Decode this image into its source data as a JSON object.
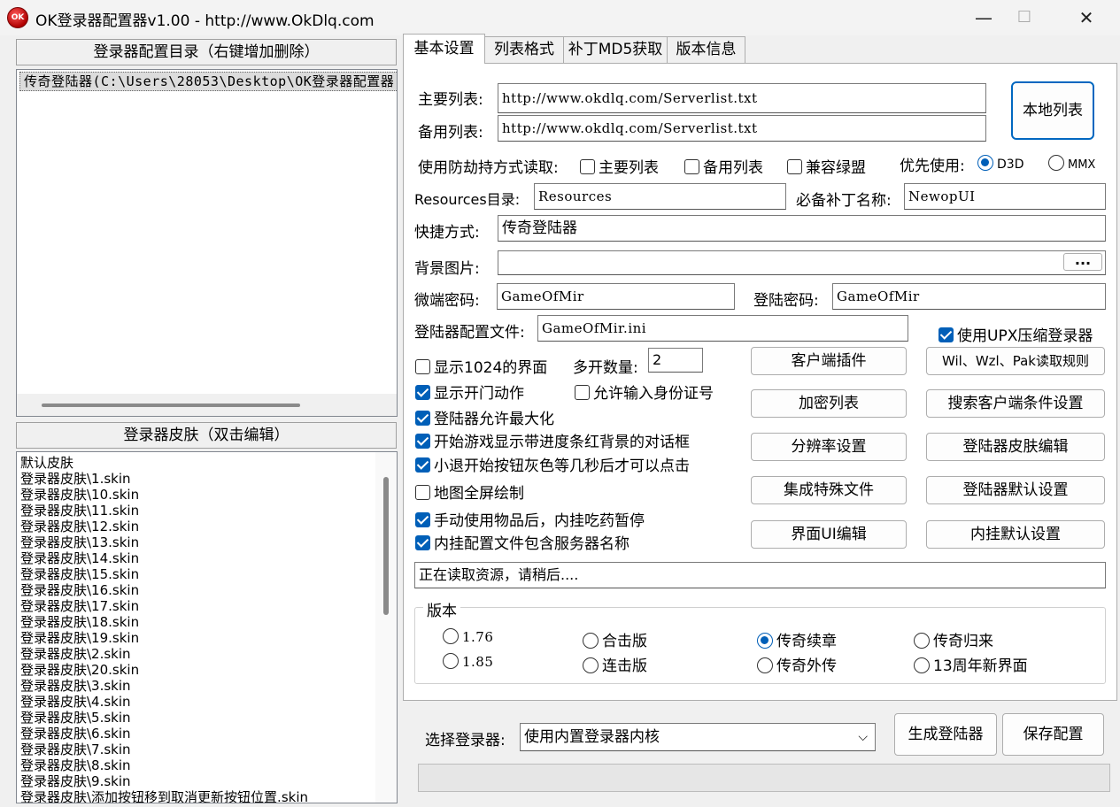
{
  "window": {
    "title": "OK登录器配置器v1.00 - http://www.OkDlq.com",
    "icon": "OK",
    "minimize_icon": "—",
    "maximize_icon": "☐",
    "close_icon": "✕"
  },
  "left": {
    "config_header": "登录器配置目录（右键增加删除）",
    "config_item": "传奇登陆器(C:\\Users\\28053\\Desktop\\OK登录器配置器",
    "skin_header": "登录器皮肤（双击编辑）",
    "skins": [
      "默认皮肤",
      "登录器皮肤\\1.skin",
      "登录器皮肤\\10.skin",
      "登录器皮肤\\11.skin",
      "登录器皮肤\\12.skin",
      "登录器皮肤\\13.skin",
      "登录器皮肤\\14.skin",
      "登录器皮肤\\15.skin",
      "登录器皮肤\\16.skin",
      "登录器皮肤\\17.skin",
      "登录器皮肤\\18.skin",
      "登录器皮肤\\19.skin",
      "登录器皮肤\\2.skin",
      "登录器皮肤\\20.skin",
      "登录器皮肤\\3.skin",
      "登录器皮肤\\4.skin",
      "登录器皮肤\\5.skin",
      "登录器皮肤\\6.skin",
      "登录器皮肤\\7.skin",
      "登录器皮肤\\8.skin",
      "登录器皮肤\\9.skin",
      "登录器皮肤\\添加按钮移到取消更新按钮位置.skin"
    ]
  },
  "tabs": [
    "基本设置",
    "列表格式",
    "补丁MD5获取",
    "版本信息"
  ],
  "basic": {
    "main_list_label": "主要列表:",
    "main_list_value": "http://www.okdlq.com/Serverlist.txt",
    "backup_list_label": "备用列表:",
    "backup_list_value": "http://www.okdlq.com/Serverlist.txt",
    "local_list_button": "本地列表",
    "anti_hijack_label": "使用防劫持方式读取:",
    "cb_main_list": "主要列表",
    "cb_backup_list": "备用列表",
    "cb_compat": "兼容绿盟",
    "priority_label": "优先使用:",
    "rb_d3d": "D3D",
    "rb_mmx": "MMX",
    "resources_label": "Resources目录:",
    "resources_value": "Resources",
    "patch_label": "必备补丁名称:",
    "patch_value": "NewopUI",
    "shortcut_label": "快捷方式:",
    "shortcut_value": "传奇登陆器",
    "bg_label": "背景图片:",
    "bg_value": "",
    "browse_button": "...",
    "micro_pwd_label": "微端密码:",
    "micro_pwd_value": "GameOfMir",
    "login_pwd_label": "登陆密码:",
    "login_pwd_value": "GameOfMir",
    "config_file_label": "登陆器配置文件:",
    "config_file_value": "GameOfMir.ini",
    "cb_upx": "使用UPX压缩登录器",
    "cb_1024": "显示1024的界面",
    "multi_label": "多开数量:",
    "multi_value": "2",
    "cb_door": "显示开门动作",
    "cb_id": "允许输入身份证号",
    "cb_maximize": "登陆器允许最大化",
    "cb_progress": "开始游戏显示带进度条红背景的对话框",
    "cb_gray": "小退开始按钮灰色等几秒后才可以点击",
    "cb_fullmap": "地图全屏绘制",
    "cb_pause": "手动使用物品后，内挂吃药暂停",
    "cb_servername": "内挂配置文件包含服务器名称",
    "btn_client_plugin": "客户端插件",
    "btn_wil_rules": "Wil、Wzl、Pak读取规则",
    "btn_encrypt_list": "加密列表",
    "btn_search_client": "搜索客户端条件设置",
    "btn_resolution": "分辨率设置",
    "btn_skin_edit": "登陆器皮肤编辑",
    "btn_special_files": "集成特殊文件",
    "btn_default_settings": "登陆器默认设置",
    "btn_ui_edit": "界面UI编辑",
    "btn_plugin_default": "内挂默认设置",
    "status": "正在读取资源，请稍后....",
    "version_group": "版本",
    "versions": [
      "1.76",
      "合击版",
      "传奇续章",
      "传奇归来",
      "1.85",
      "连击版",
      "传奇外传",
      "13周年新界面"
    ]
  },
  "footer": {
    "select_label": "选择登录器:",
    "select_value": "使用内置登录器内核",
    "generate_button": "生成登陆器",
    "save_button": "保存配置"
  }
}
